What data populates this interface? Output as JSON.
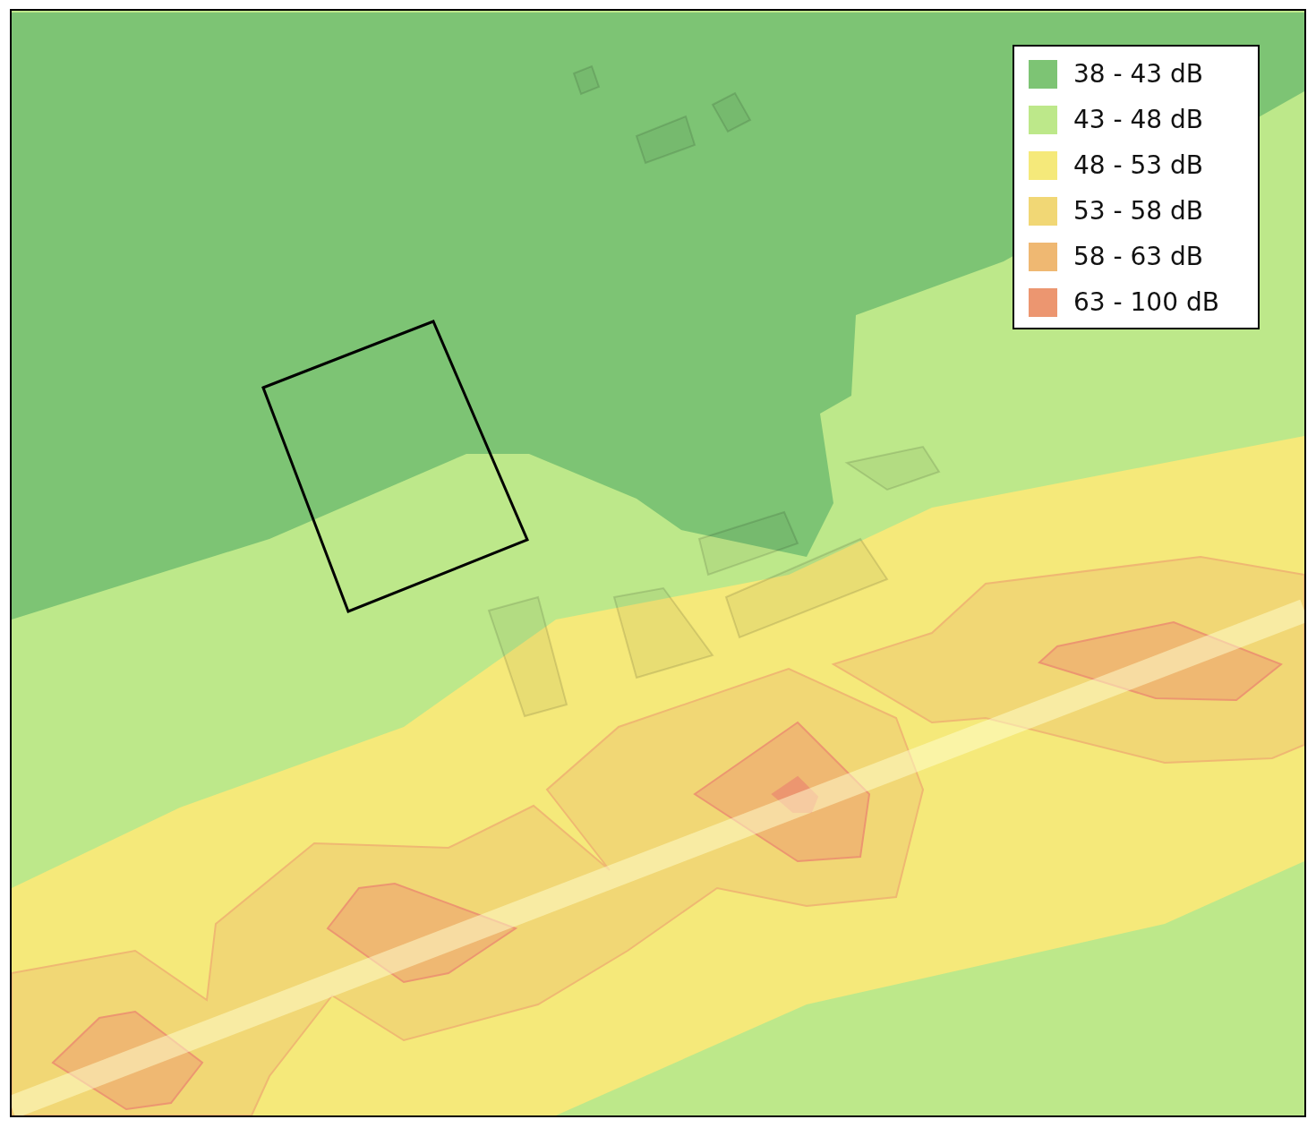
{
  "legend": [
    {
      "label": "38 - 43 dB",
      "color": "#7dc474"
    },
    {
      "label": "43 - 48 dB",
      "color": "#bde88a"
    },
    {
      "label": "48 - 53 dB",
      "color": "#f5e97a"
    },
    {
      "label": "53 - 58 dB",
      "color": "#f1d775"
    },
    {
      "label": "58 - 63 dB",
      "color": "#efb872"
    },
    {
      "label": "63 - 100 dB",
      "color": "#ec9670"
    }
  ]
}
